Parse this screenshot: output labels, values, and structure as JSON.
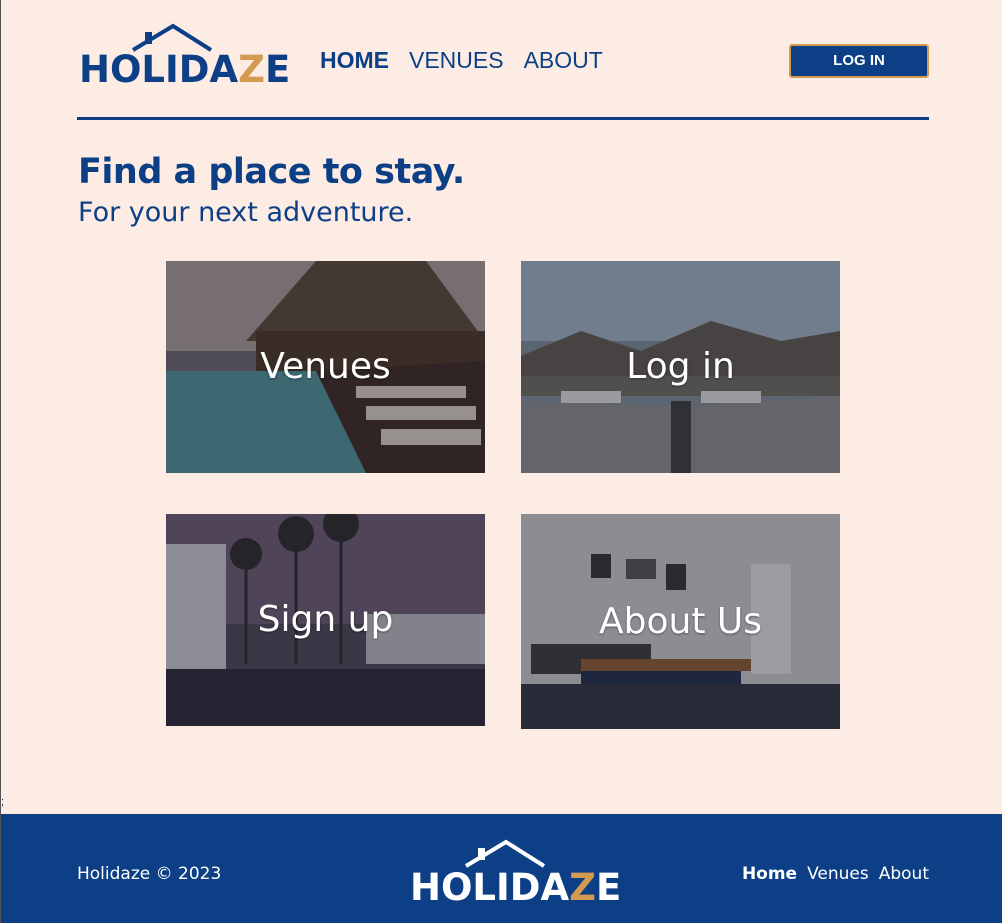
{
  "brand": {
    "name_main": "HOLIDA",
    "name_z": "Z",
    "name_end": "E"
  },
  "nav": {
    "items": [
      "HOME",
      "VENUES",
      "ABOUT"
    ],
    "active": "HOME"
  },
  "header": {
    "login_label": "LOG IN"
  },
  "hero": {
    "title": "Find a place to stay.",
    "subtitle": "For your next adventure."
  },
  "cards": [
    {
      "label": "Venues"
    },
    {
      "label": "Log in"
    },
    {
      "label": "Sign up"
    },
    {
      "label": "About Us"
    }
  ],
  "footer": {
    "copyright": "Holidaze © 2023",
    "links": [
      "Home",
      "Venues",
      "About"
    ]
  },
  "colors": {
    "primary": "#0c3f85",
    "background": "#fcece4",
    "accent": "#d49a52"
  }
}
